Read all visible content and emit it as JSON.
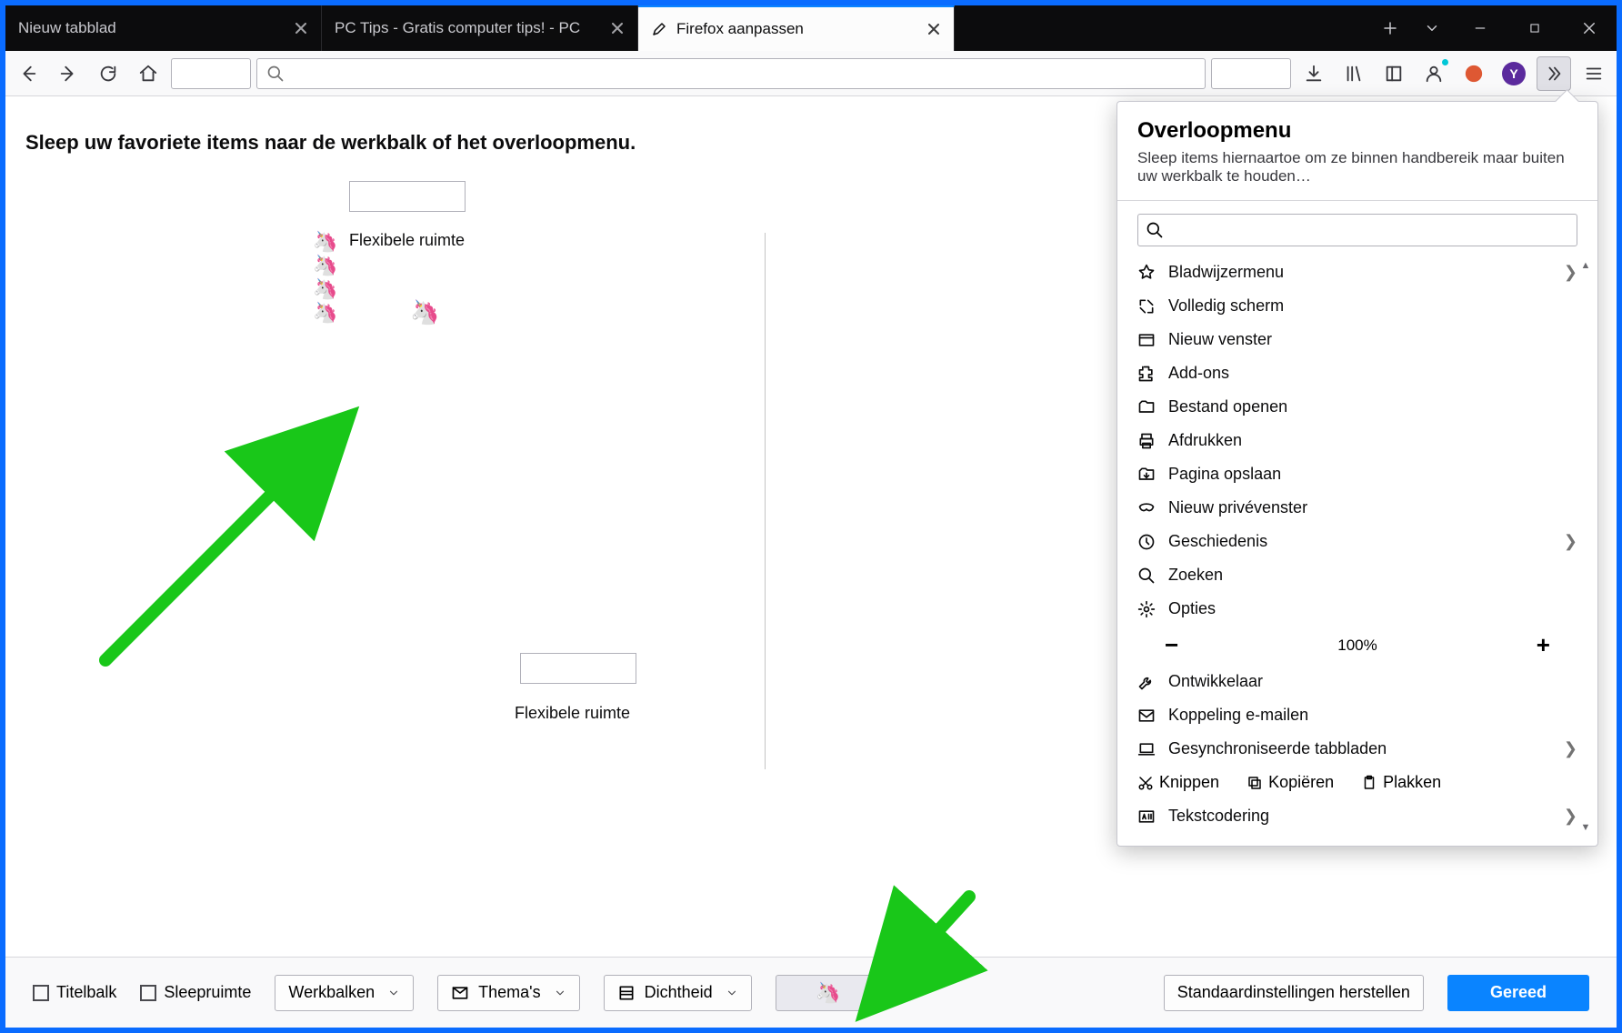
{
  "tabs": [
    {
      "label": "Nieuw tabblad"
    },
    {
      "label": "PC Tips - Gratis computer tips! - PC"
    },
    {
      "label": "Firefox aanpassen"
    }
  ],
  "instruction": "Sleep uw favoriete items naar de werkbalk of het overloopmenu.",
  "flex_label_1": "Flexibele ruimte",
  "flex_label_2": "Flexibele ruimte",
  "avatar_letter": "Y",
  "panel": {
    "title": "Overloopmenu",
    "desc": "Sleep items hiernaartoe om ze binnen handbereik maar buiten uw werkbalk te houden…",
    "items": [
      {
        "label": "Bladwijzermenu",
        "chevron": true
      },
      {
        "label": "Volledig scherm"
      },
      {
        "label": "Nieuw venster"
      },
      {
        "label": "Add-ons"
      },
      {
        "label": "Bestand openen"
      },
      {
        "label": "Afdrukken"
      },
      {
        "label": "Pagina opslaan"
      },
      {
        "label": "Nieuw privévenster"
      },
      {
        "label": "Geschiedenis",
        "chevron": true
      },
      {
        "label": "Zoeken"
      },
      {
        "label": "Opties"
      }
    ],
    "zoom": "100%",
    "items2": [
      {
        "label": "Ontwikkelaar"
      },
      {
        "label": "Koppeling e-mailen"
      },
      {
        "label": "Gesynchroniseerde tabbladen",
        "chevron": true
      }
    ],
    "edit": {
      "cut": "Knippen",
      "copy": "Kopiëren",
      "paste": "Plakken"
    },
    "encoding": {
      "label": "Tekstcodering",
      "chevron": true
    }
  },
  "bottom": {
    "titelbalk": "Titelbalk",
    "sleepruimte": "Sleepruimte",
    "werkbalken": "Werkbalken",
    "themas": "Thema's",
    "dichtheid": "Dichtheid",
    "restore": "Standaardinstellingen herstellen",
    "done": "Gereed"
  }
}
